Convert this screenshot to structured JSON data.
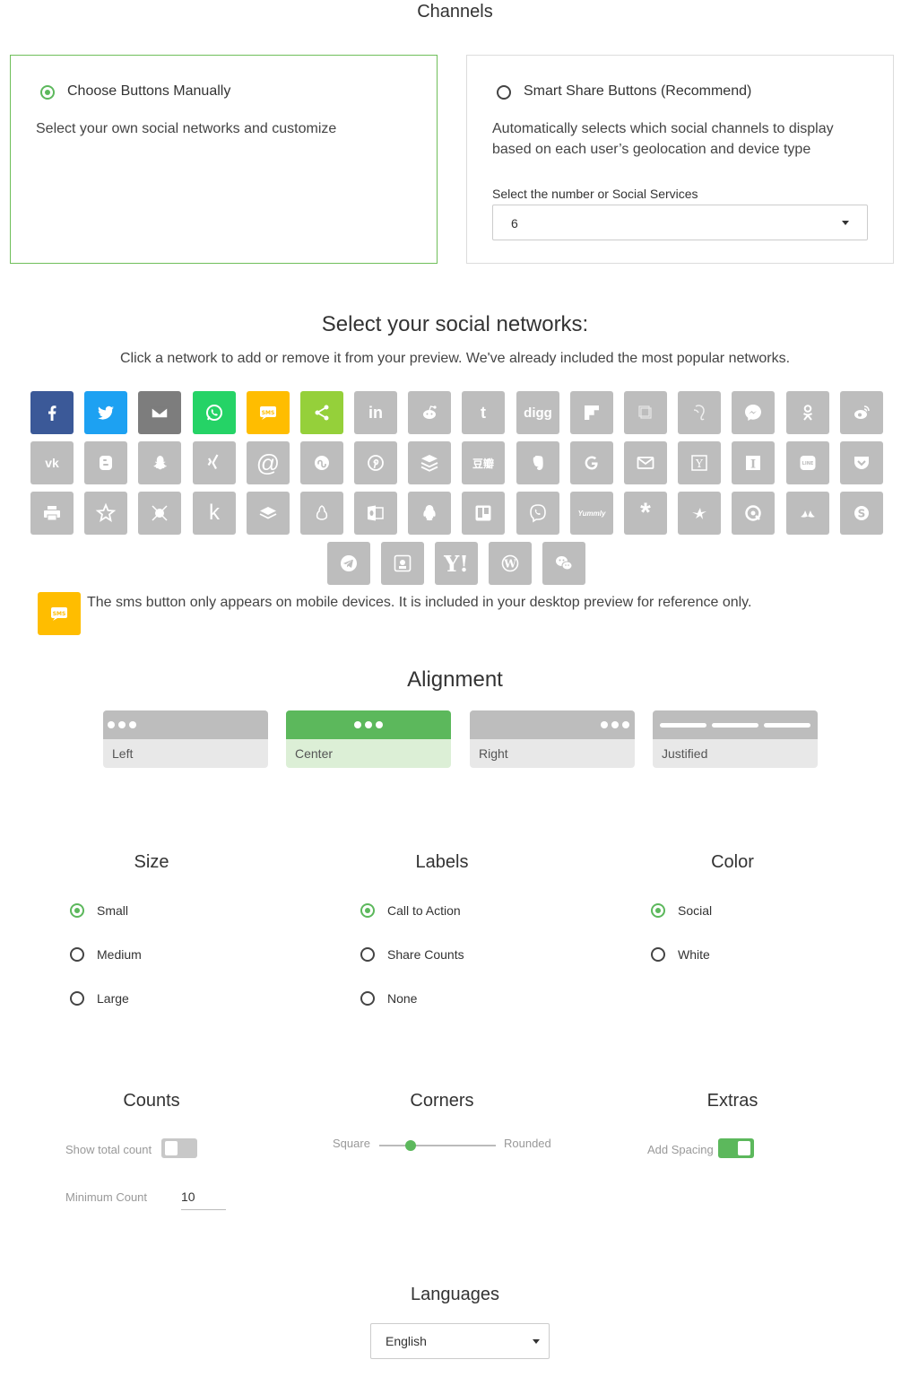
{
  "channels": {
    "heading": "Channels",
    "manual": {
      "title": "Choose Buttons Manually",
      "description": "Select your own social networks and customize",
      "selected": true
    },
    "smart": {
      "title": "Smart Share Buttons (Recommend)",
      "description_line1": "Automatically selects which social channels to display",
      "description_line2": "based on each user’s geolocation and device type",
      "select_label": "Select the number or Social Services",
      "select_value": "6",
      "selected": false
    }
  },
  "networks": {
    "heading": "Select your social networks:",
    "subheading": "Click a network to add or remove it from your preview. We've already included the most popular networks.",
    "sms_note": "The sms button only appears on mobile devices. It is included in your desktop preview for reference only.",
    "active_colors": {
      "facebook": "#3b5998",
      "twitter": "#1da1f2",
      "email": "#7d7d7d",
      "whatsapp": "#25d366",
      "sms": "#ffbd00",
      "sharethis": "#95d03a"
    },
    "inactive_color": "#bdbdbd",
    "tiles_row1": [
      "facebook",
      "twitter",
      "email",
      "whatsapp",
      "sms",
      "sharethis",
      "linkedin",
      "reddit",
      "tumblr",
      "digg",
      "flipboard",
      "copy",
      "evernote-alt",
      "messenger",
      "odnoklassniki",
      "weibo"
    ],
    "tiles_row2": [
      "vk",
      "blogger",
      "snapchat",
      "xing",
      "mailru",
      "stumbleupon",
      "pinterest",
      "buffer",
      "douban",
      "evernote",
      "google",
      "gmail",
      "yummly-y",
      "instapaper",
      "line",
      "pocket"
    ],
    "tiles_row3": [
      "print",
      "meneame",
      "refind",
      "kik",
      "delicious",
      "tencent-qq",
      "outlook",
      "qzone",
      "trello",
      "viber",
      "yummly",
      "livejournal",
      "surfingbird",
      "threema",
      "renren",
      "skype"
    ],
    "tiles_row4": [
      "telegram",
      "vk-classic",
      "yahoo",
      "wordpress",
      "wechat"
    ],
    "labels": {
      "linkedin": "in",
      "tumblr": "t",
      "digg": "digg",
      "yummly": "Yummly",
      "sms": "SMS"
    }
  },
  "alignment": {
    "heading": "Alignment",
    "options": [
      "Left",
      "Center",
      "Right",
      "Justified"
    ],
    "selected": "Center"
  },
  "size": {
    "heading": "Size",
    "options": [
      "Small",
      "Medium",
      "Large"
    ],
    "selected": "Small"
  },
  "labels": {
    "heading": "Labels",
    "options": [
      "Call to Action",
      "Share Counts",
      "None"
    ],
    "selected": "Call to Action"
  },
  "color": {
    "heading": "Color",
    "options": [
      "Social",
      "White"
    ],
    "selected": "Social"
  },
  "counts": {
    "heading": "Counts",
    "show_total_label": "Show total count",
    "show_total_on": false,
    "min_count_label": "Minimum Count",
    "min_count_value": "10"
  },
  "corners": {
    "heading": "Corners",
    "left_label": "Square",
    "right_label": "Rounded",
    "value_percent": 27
  },
  "extras": {
    "heading": "Extras",
    "spacing_label": "Add Spacing",
    "spacing_on": true
  },
  "languages": {
    "heading": "Languages",
    "value": "English"
  },
  "accent": "#5cb85c"
}
